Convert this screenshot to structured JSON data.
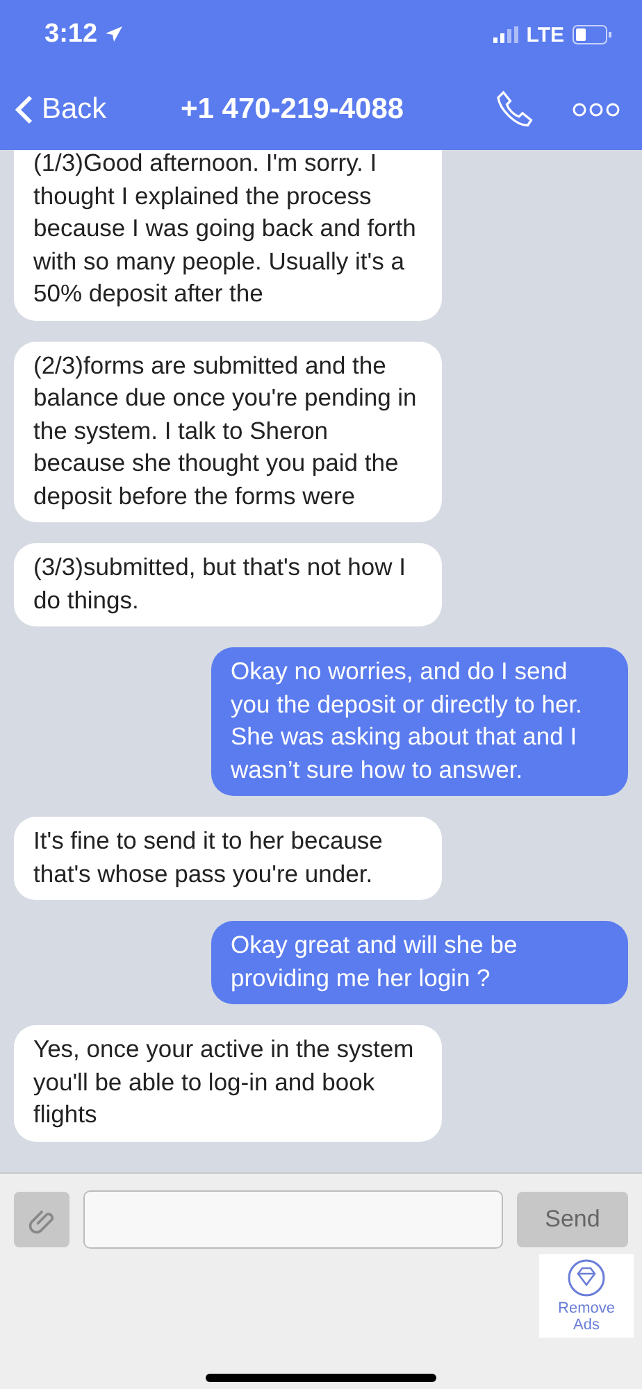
{
  "status_bar": {
    "time": "3:12",
    "network": "LTE"
  },
  "nav": {
    "back": "Back",
    "title": "+1 470-219-4088"
  },
  "messages": [
    {
      "kind": "incoming",
      "text": "(1/3)Good afternoon. I'm sorry. I thought I explained the process because I was going back and forth with so many people. Usually it's a 50% deposit after the"
    },
    {
      "kind": "incoming",
      "text": "(2/3)forms are submitted and the balance due once you're pending in the system. I talk to Sheron because she thought you paid the deposit before the forms were"
    },
    {
      "kind": "incoming",
      "text": "(3/3)submitted, but that's not how I do things."
    },
    {
      "kind": "outgoing",
      "text": "Okay no worries, and do I send you the deposit or directly to her. She was asking about that and I wasn’t sure how to answer."
    },
    {
      "kind": "incoming",
      "text": "It's fine to send it to her because that's whose pass you're under."
    },
    {
      "kind": "outgoing",
      "text": "Okay great and will she be providing me her login ?"
    },
    {
      "kind": "incoming",
      "text": "Yes, once your active in the system you'll be able to log-in and book flights"
    }
  ],
  "composer": {
    "send": "Send",
    "remove_ads": "Remove Ads"
  }
}
